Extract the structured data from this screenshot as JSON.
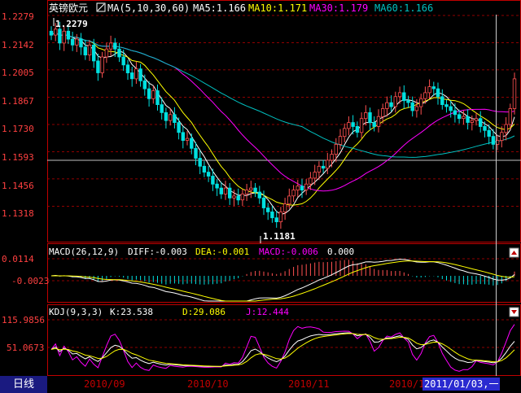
{
  "instrument": "英镑欧元",
  "colors": {
    "up": "#ff5050",
    "down": "#00e0e0",
    "ma5": "#ffffff",
    "ma10": "#ffff00",
    "ma30": "#ff00ff",
    "ma60": "#00c0c0",
    "grid": "#c00000",
    "axis_text": "#ff4040"
  },
  "main_panel": {
    "legend": {
      "ma_label": "MA(5,10,30,60)",
      "ma5": "MA5:1.166",
      "ma10": "MA10:1.171",
      "ma30": "MA30:1.179",
      "ma60": "MA60:1.166"
    },
    "y_ticks": [
      "1.2279",
      "1.2142",
      "1.2005",
      "1.1867",
      "1.1730",
      "1.1593",
      "1.1456",
      "1.1318"
    ],
    "high_label": "1.2279",
    "low_label": "1.1181"
  },
  "macd_panel": {
    "legend": {
      "title": "MACD(26,12,9)",
      "diff": "DIFF:-0.003",
      "dea": "DEA:-0.001",
      "macd": "MACD:-0.006",
      "extra": "0.000"
    },
    "y_ticks": [
      "0.0114",
      "-0.0023"
    ]
  },
  "kdj_panel": {
    "legend": {
      "title": "KDJ(9,3,3)",
      "k": "K:23.538",
      "d": "D:29.086",
      "j": "J:12.444"
    },
    "y_ticks": [
      "115.9856",
      "51.0673"
    ]
  },
  "bottom_bar": {
    "tab_label": "日线",
    "dates": [
      "2010/09",
      "2010/10",
      "2010/11",
      "2010/1"
    ],
    "cursor_date": "2011/01/03,一"
  },
  "chart_data": [
    {
      "type": "candlestick",
      "title": "英镑欧元",
      "x_labels": [
        "2010/09",
        "2010/10",
        "2010/11",
        "2010/12"
      ],
      "ylim": [
        1.1181,
        1.2279
      ],
      "series": [
        {
          "name": "MA5",
          "value": 1.166
        },
        {
          "name": "MA10",
          "value": 1.171
        },
        {
          "name": "MA30",
          "value": 1.179
        },
        {
          "name": "MA60",
          "value": 1.166
        }
      ],
      "closes": [
        1.218,
        1.221,
        1.214,
        1.22,
        1.216,
        1.213,
        1.216,
        1.212,
        1.208,
        1.213,
        1.205,
        1.199,
        1.207,
        1.211,
        1.214,
        1.211,
        1.207,
        1.203,
        1.199,
        1.196,
        1.201,
        1.195,
        1.191,
        1.186,
        1.19,
        1.183,
        1.179,
        1.175,
        1.178,
        1.174,
        1.169,
        1.165,
        1.166,
        1.161,
        1.156,
        1.152,
        1.149,
        1.147,
        1.143,
        1.141,
        1.138,
        1.141,
        1.136,
        1.137,
        1.135,
        1.138,
        1.14,
        1.141,
        1.139,
        1.136,
        1.131,
        1.129,
        1.126,
        1.124,
        1.129,
        1.133,
        1.137,
        1.14,
        1.142,
        1.14,
        1.143,
        1.146,
        1.149,
        1.152,
        1.151,
        1.155,
        1.158,
        1.163,
        1.167,
        1.171,
        1.174,
        1.172,
        1.169,
        1.176,
        1.179,
        1.174,
        1.172,
        1.177,
        1.181,
        1.184,
        1.182,
        1.187,
        1.189,
        1.185,
        1.184,
        1.18,
        1.182,
        1.186,
        1.189,
        1.192,
        1.191,
        1.187,
        1.183,
        1.182,
        1.18,
        1.178,
        1.176,
        1.177,
        1.174,
        1.175,
        1.176,
        1.172,
        1.17,
        1.167,
        1.163,
        1.165,
        1.169,
        1.173,
        1.181,
        1.196
      ],
      "low": 1.1181,
      "high": 1.2279
    },
    {
      "type": "line",
      "title": "MACD(26,12,9)",
      "series": [
        {
          "name": "DIFF",
          "value": -0.003
        },
        {
          "name": "DEA",
          "value": -0.001
        },
        {
          "name": "MACD",
          "value": -0.006
        }
      ],
      "yticks": [
        0.0114,
        -0.0023
      ]
    },
    {
      "type": "line",
      "title": "KDJ(9,3,3)",
      "series": [
        {
          "name": "K",
          "value": 23.538
        },
        {
          "name": "D",
          "value": 29.086
        },
        {
          "name": "J",
          "value": 12.444
        }
      ],
      "yticks": [
        115.9856,
        51.0673
      ]
    }
  ]
}
